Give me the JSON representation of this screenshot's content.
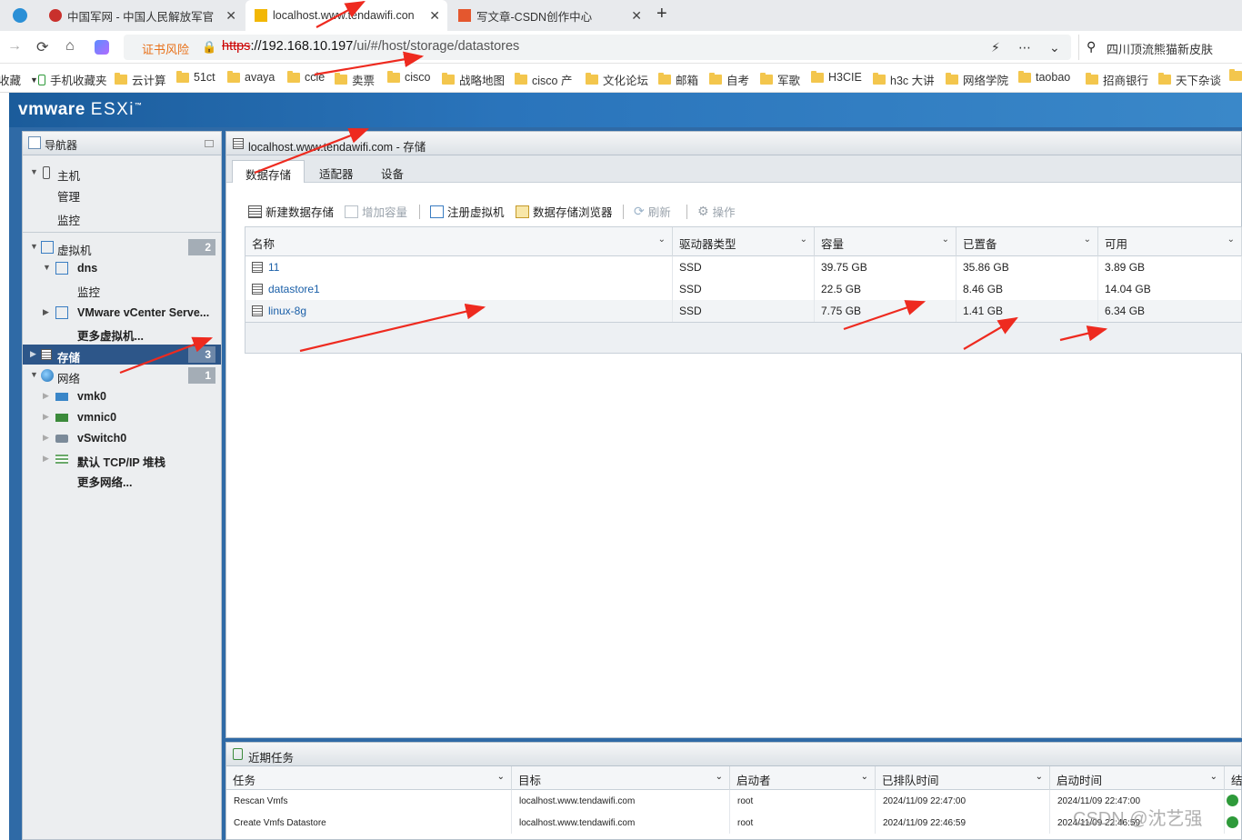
{
  "browser": {
    "tabs": [
      {
        "title": "中国军网 - 中国人民解放军官"
      },
      {
        "title": "localhost.www.tendawifi.con"
      },
      {
        "title": "写文章-CSDN创作中心"
      }
    ],
    "new_tab": "+",
    "close": "✕",
    "cert_warning": "证书风险",
    "url_scheme": "https",
    "url_host": "://192.168.10.197",
    "url_path": "/ui/#/host/storage/datastores",
    "search_query": "四川顶流熊猫新皮肤",
    "bookmarks": [
      "收藏",
      "手机收藏夹",
      "云计算",
      "51ct",
      "avaya",
      "ccie",
      "卖票",
      "cisco",
      "战略地图",
      "cisco 产",
      "文化论坛",
      "邮箱",
      "自考",
      "军歌",
      "H3CIE",
      "h3c 大讲",
      "网络学院",
      "taobao",
      "招商银行",
      "天下杂谈"
    ]
  },
  "esxi": {
    "logo_vm": "vmware",
    "logo_product": "ESXi",
    "navigator": {
      "title": "导航器",
      "host": "主机",
      "host_manage": "管理",
      "host_monitor": "监控",
      "vms": "虚拟机",
      "vms_count": "2",
      "vm_dns": "dns",
      "vm_dns_monitor": "监控",
      "vm_vcenter": "VMware vCenter Serve...",
      "more_vms": "更多虚拟机...",
      "storage": "存储",
      "storage_count": "3",
      "network": "网络",
      "network_count": "1",
      "net_vmk0": "vmk0",
      "net_vmnic0": "vmnic0",
      "net_vswitch0": "vSwitch0",
      "net_tcpip": "默认 TCP/IP 堆栈",
      "more_networks": "更多网络..."
    },
    "main": {
      "title": "localhost.www.tendawifi.com - 存储",
      "tabs": [
        "数据存储",
        "适配器",
        "设备"
      ],
      "toolbar": {
        "new_datastore": "新建数据存储",
        "increase_capacity": "增加容量",
        "register_vm": "注册虚拟机",
        "datastore_browser": "数据存储浏览器",
        "refresh": "刷新",
        "actions": "操作"
      },
      "columns": [
        "名称",
        "驱动器类型",
        "容量",
        "已置备",
        "可用"
      ],
      "rows": [
        {
          "name": "11",
          "drive": "SSD",
          "capacity": "39.75 GB",
          "provisioned": "35.86 GB",
          "free": "3.89 GB"
        },
        {
          "name": "datastore1",
          "drive": "SSD",
          "capacity": "22.5 GB",
          "provisioned": "8.46 GB",
          "free": "14.04 GB"
        },
        {
          "name": "linux-8g",
          "drive": "SSD",
          "capacity": "7.75 GB",
          "provisioned": "1.41 GB",
          "free": "6.34 GB"
        }
      ]
    },
    "tasks": {
      "title": "近期任务",
      "columns": [
        "任务",
        "目标",
        "启动者",
        "已排队时间",
        "启动时间",
        "结"
      ],
      "rows": [
        {
          "task": "Rescan Vmfs",
          "target": "localhost.www.tendawifi.com",
          "initiator": "root",
          "queued": "2024/11/09 22:47:00",
          "started": "2024/11/09 22:47:00"
        },
        {
          "task": "Create Vmfs Datastore",
          "target": "localhost.www.tendawifi.com",
          "initiator": "root",
          "queued": "2024/11/09 22:46:59",
          "started": "2024/11/09 22:46:59"
        }
      ]
    }
  },
  "watermark": "CSDN @沈艺强",
  "colors": {
    "accent": "#2d5689",
    "arrow": "#ee2a1f",
    "link": "#1a5fa8",
    "ok": "#2e9a3a"
  }
}
